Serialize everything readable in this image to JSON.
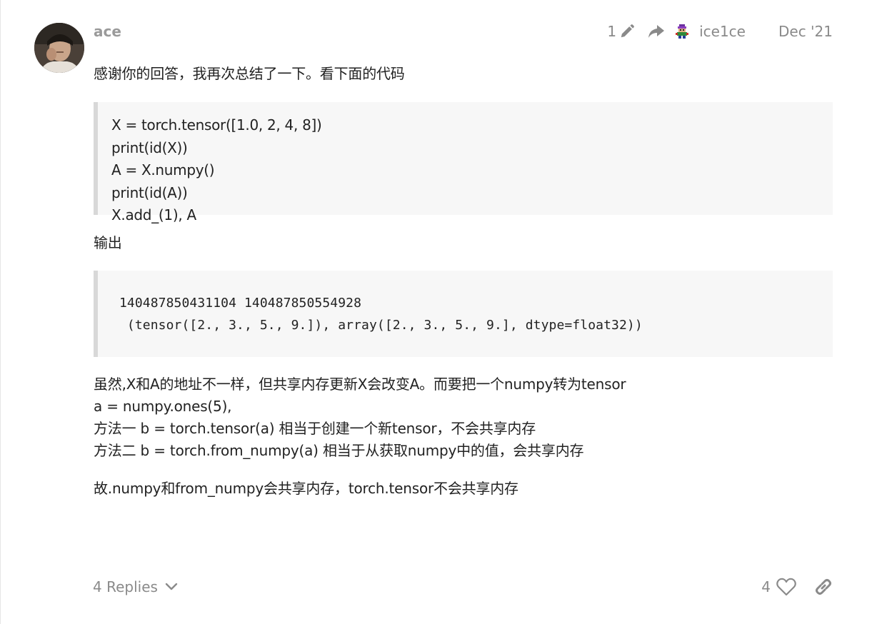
{
  "post": {
    "username": "ace",
    "edit_count": "1",
    "reply_to_user": "ice1ce",
    "date": "Dec '21",
    "paragraph_1": "感谢你的回答，我再次总结了一下。看下面的代码",
    "code_1": [
      "X = torch.tensor([1.0, 2, 4, 8])",
      "print(id(X))",
      "A = X.numpy()",
      "print(id(A))",
      "X.add_(1), A"
    ],
    "output_label": "输出",
    "code_2": [
      "140487850431104 140487850554928",
      " (tensor([2., 3., 5., 9.]), array([2., 3., 5., 9.], dtype=float32))"
    ],
    "paragraph_3": "虽然,X和A的地址不一样，但共享内存更新X会改变A。而要把一个numpy转为tensor\na = numpy.ones(5),\n方法一 b = torch.tensor(a) 相当于创建一个新tensor，不会共享内存\n方法二 b = torch.from_numpy(a) 相当于从获取numpy中的值，会共享内存",
    "paragraph_4": "故.numpy和from_numpy会共享内存，torch.tensor不会共享内存"
  },
  "footer": {
    "replies_label": "4 Replies",
    "like_count": "4"
  },
  "icons": {
    "edit": "pencil-icon",
    "reply": "share-arrow-icon",
    "reply_avatar": "pixel-avatar-icon",
    "expand": "chevron-down-icon",
    "like": "heart-icon",
    "link": "link-icon"
  },
  "colors": {
    "muted_text": "#8a8a8a",
    "body_text": "#222222",
    "code_bg": "#f7f7f7",
    "code_border": "#d8d8d8"
  }
}
